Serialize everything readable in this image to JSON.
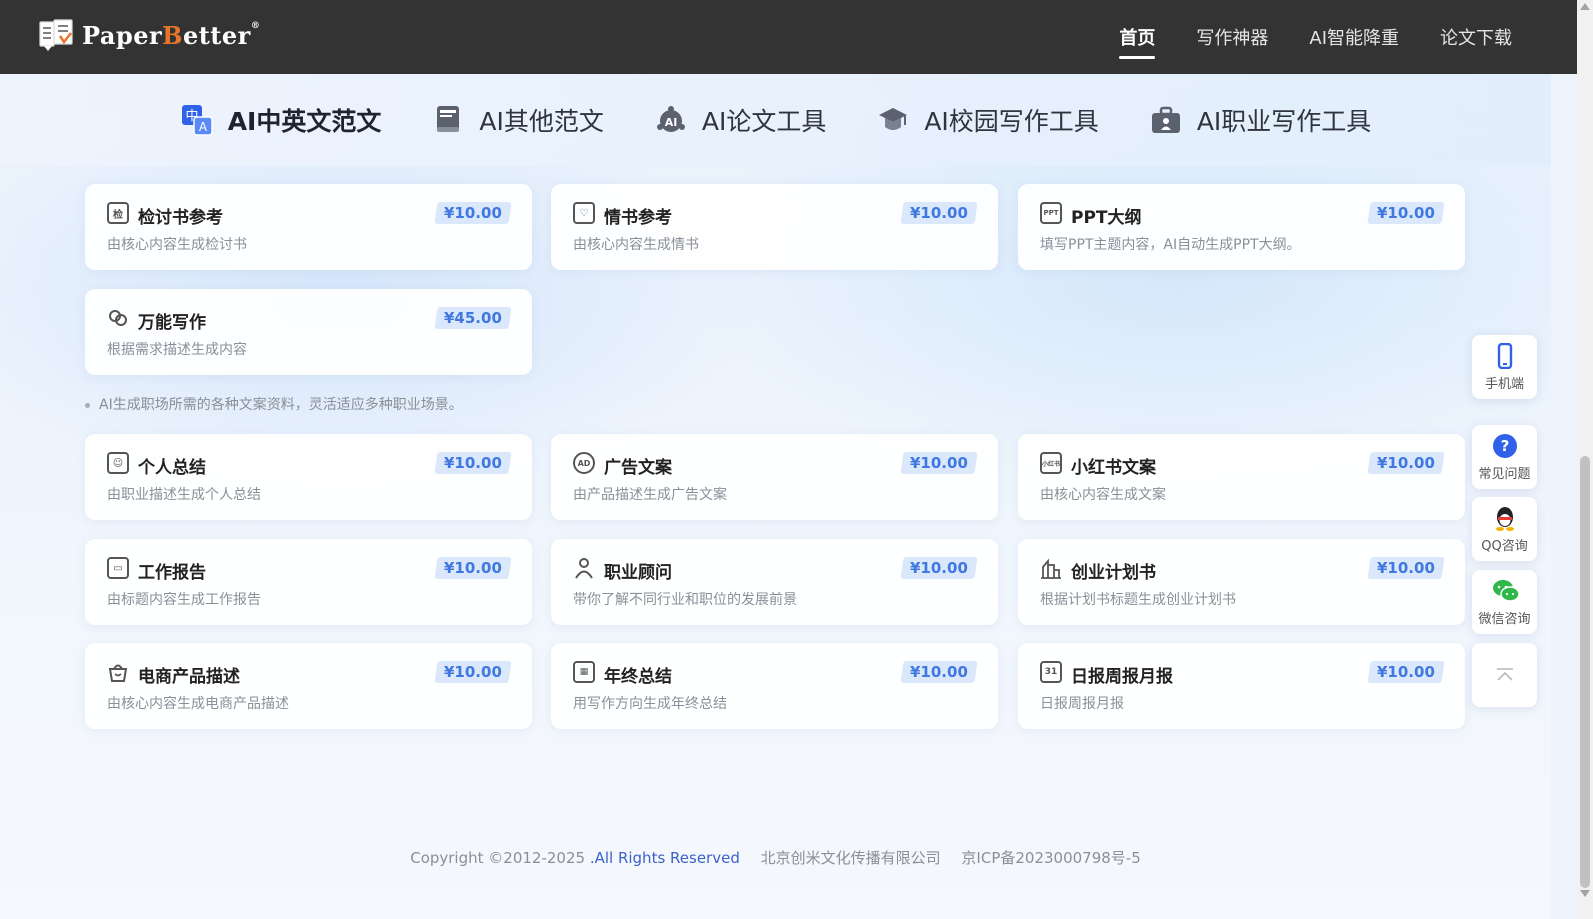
{
  "header": {
    "logo_prefix": "Paper",
    "logo_b": "B",
    "logo_suffix": "etter",
    "logo_reg": "®",
    "nav": [
      "首页",
      "写作神器",
      "AI智能降重",
      "论文下载"
    ]
  },
  "categories": [
    "AI中英文范文",
    "AI其他范文",
    "AI论文工具",
    "AI校园写作工具",
    "AI职业写作工具"
  ],
  "cards_top": [
    {
      "title": "检讨书参考",
      "desc": "由核心内容生成检讨书",
      "price": "¥10.00",
      "icon": "document-icon"
    },
    {
      "title": "情书参考",
      "desc": "由核心内容生成情书",
      "price": "¥10.00",
      "icon": "heart-letter-icon"
    },
    {
      "title": "PPT大纲",
      "desc": "填写PPT主题内容，AI自动生成PPT大纲。",
      "price": "¥10.00",
      "icon": "ppt-icon"
    },
    {
      "title": "万能写作",
      "desc": "根据需求描述生成内容",
      "price": "¥45.00",
      "icon": "link-icon"
    }
  ],
  "note": "AI生成职场所需的各种文案资料，灵活适应多种职业场景。",
  "cards_bottom": [
    {
      "title": "个人总结",
      "desc": "由职业描述生成个人总结",
      "price": "¥10.00",
      "icon": "person-doc-icon"
    },
    {
      "title": "广告文案",
      "desc": "由产品描述生成广告文案",
      "price": "¥10.00",
      "icon": "ad-icon"
    },
    {
      "title": "小红书文案",
      "desc": "由核心内容生成文案",
      "price": "¥10.00",
      "icon": "xiaohongshu-icon"
    },
    {
      "title": "工作报告",
      "desc": "由标题内容生成工作报告",
      "price": "¥10.00",
      "icon": "briefcase-icon"
    },
    {
      "title": "职业顾问",
      "desc": "带你了解不同行业和职位的发展前景",
      "price": "¥10.00",
      "icon": "advisor-icon"
    },
    {
      "title": "创业计划书",
      "desc": "根据计划书标题生成创业计划书",
      "price": "¥10.00",
      "icon": "building-icon"
    },
    {
      "title": "电商产品描述",
      "desc": "由核心内容生成电商产品描述",
      "price": "¥10.00",
      "icon": "basket-icon"
    },
    {
      "title": "年终总结",
      "desc": "用写作方向生成年终总结",
      "price": "¥10.00",
      "icon": "calendar-icon"
    },
    {
      "title": "日报周报月报",
      "desc": "日报周报月报",
      "price": "¥10.00",
      "icon": "calendar-day-icon"
    }
  ],
  "footer": {
    "copyright": "Copyright ©2012-2025 ",
    "rights": ".All Rights Reserved",
    "company": "北京创米文化传播有限公司",
    "icp": "京ICP备2023000798号-5"
  },
  "side": [
    "手机端",
    "常见问题",
    "QQ咨询",
    "微信咨询"
  ],
  "colors": {
    "accent": "#3f78e0",
    "topbar": "#333333",
    "price_bg": "#dbe7fb"
  }
}
